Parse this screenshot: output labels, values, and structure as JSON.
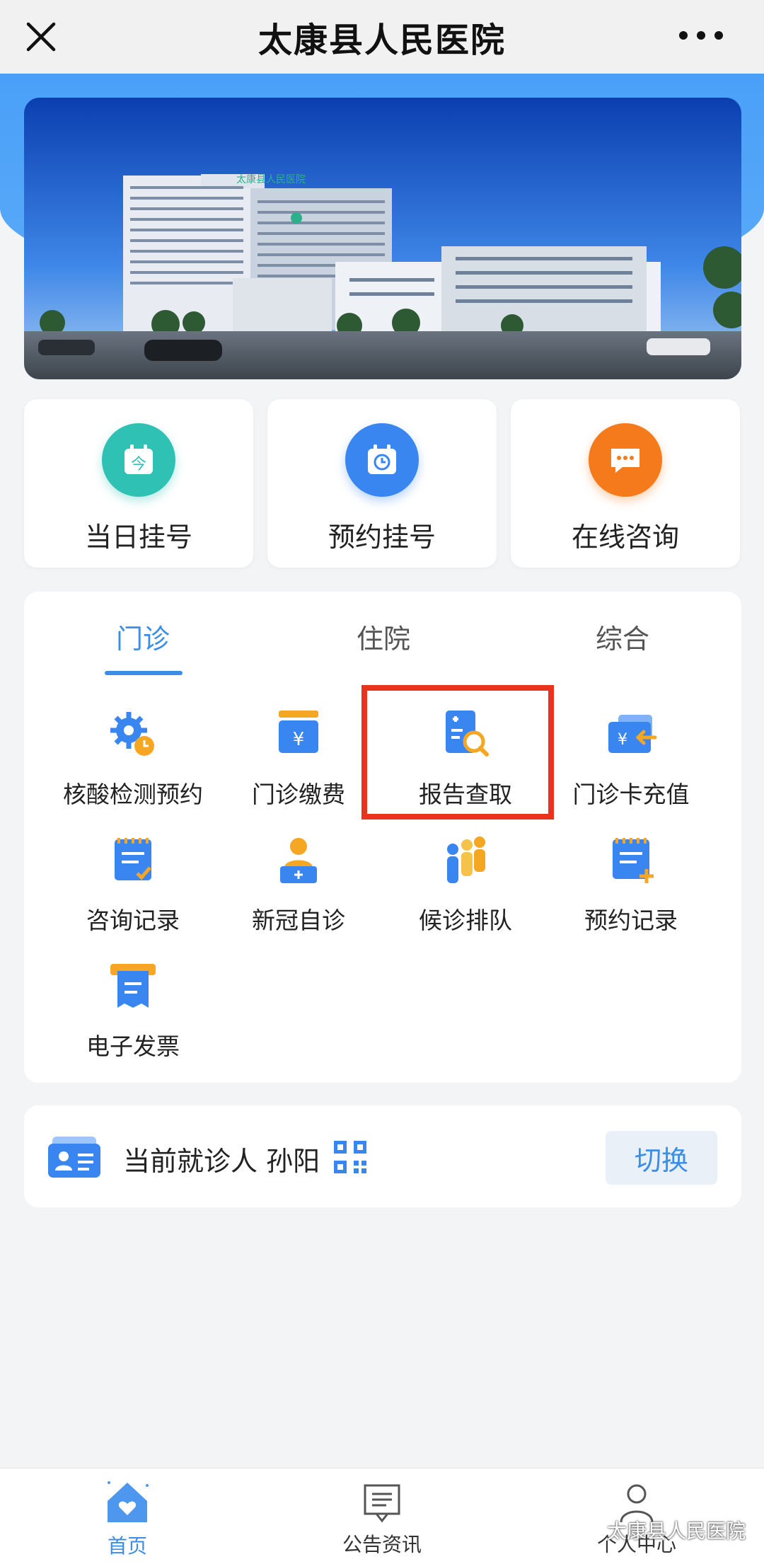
{
  "topbar": {
    "title": "太康县人民医院"
  },
  "banner": {
    "building_sign": "太康县人民医院"
  },
  "quick": [
    {
      "label": "当日挂号",
      "icon": "today-calendar-icon",
      "color": "#2fc2b4"
    },
    {
      "label": "预约挂号",
      "icon": "appointment-clock-icon",
      "color": "#3a86f0"
    },
    {
      "label": "在线咨询",
      "icon": "chat-bubble-icon",
      "color": "#f57a1c"
    }
  ],
  "tabs": [
    {
      "label": "门诊",
      "active": true
    },
    {
      "label": "住院",
      "active": false
    },
    {
      "label": "综合",
      "active": false
    }
  ],
  "services": [
    {
      "label": "核酸检测预约",
      "icon": "gear-clock-icon"
    },
    {
      "label": "门诊缴费",
      "icon": "yuan-wallet-icon"
    },
    {
      "label": "报告查取",
      "icon": "report-search-icon"
    },
    {
      "label": "门诊卡充值",
      "icon": "card-recharge-icon"
    },
    {
      "label": "咨询记录",
      "icon": "consult-record-icon"
    },
    {
      "label": "新冠自诊",
      "icon": "self-diagnosis-icon"
    },
    {
      "label": "候诊排队",
      "icon": "queue-people-icon"
    },
    {
      "label": "预约记录",
      "icon": "appointment-record-icon"
    },
    {
      "label": "电子发票",
      "icon": "e-invoice-icon"
    }
  ],
  "patient": {
    "text": "当前就诊人 孙阳",
    "switch_label": "切换"
  },
  "bottom_nav": [
    {
      "label": "首页",
      "icon": "home-heart-icon",
      "active": true
    },
    {
      "label": "公告资讯",
      "icon": "notice-board-icon",
      "active": false
    },
    {
      "label": "个人中心",
      "icon": "person-icon",
      "active": false
    }
  ],
  "watermark": "太康县人民医院",
  "colors": {
    "accent": "#3a8ee6",
    "highlight": "#e8341c"
  }
}
